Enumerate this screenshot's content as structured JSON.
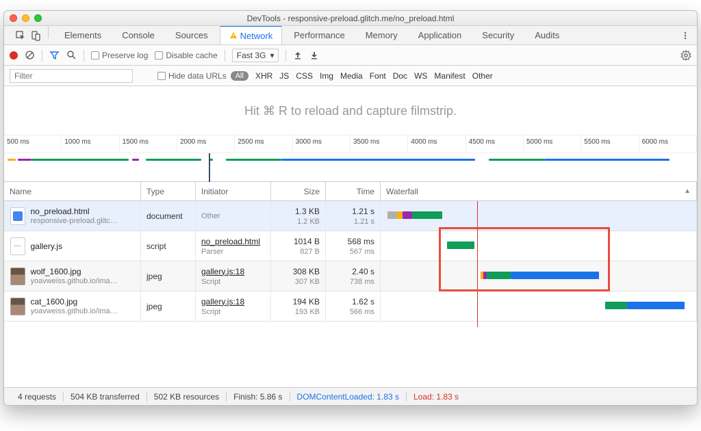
{
  "window": {
    "title": "DevTools - responsive-preload.glitch.me/no_preload.html"
  },
  "tabs": {
    "items": [
      "Elements",
      "Console",
      "Sources",
      "Network",
      "Performance",
      "Memory",
      "Application",
      "Security",
      "Audits"
    ],
    "active": "Network"
  },
  "toolbar": {
    "preserve_log": "Preserve log",
    "disable_cache": "Disable cache",
    "throttle": "Fast 3G"
  },
  "filter": {
    "placeholder": "Filter",
    "hide_data": "Hide data URLs",
    "all": "All",
    "types": [
      "XHR",
      "JS",
      "CSS",
      "Img",
      "Media",
      "Font",
      "Doc",
      "WS",
      "Manifest",
      "Other"
    ]
  },
  "banner": "Hit ⌘ R to reload and capture filmstrip.",
  "ruler": [
    "500 ms",
    "1000 ms",
    "1500 ms",
    "2000 ms",
    "2500 ms",
    "3000 ms",
    "3500 ms",
    "4000 ms",
    "4500 ms",
    "5000 ms",
    "5500 ms",
    "6000 ms"
  ],
  "columns": {
    "name": "Name",
    "type": "Type",
    "initiator": "Initiator",
    "size": "Size",
    "time": "Time",
    "waterfall": "Waterfall"
  },
  "rows": [
    {
      "name": "no_preload.html",
      "sub": "responsive-preload.glitc…",
      "type": "document",
      "initiator": "Other",
      "initiator_sub": "",
      "size": "1.3 KB",
      "size_sub": "1.2 KB",
      "time": "1.21 s",
      "time_sub": "1.21 s",
      "icon": "html"
    },
    {
      "name": "gallery.js",
      "sub": "",
      "type": "script",
      "initiator": "no_preload.html",
      "initiator_sub": "Parser",
      "size": "1014 B",
      "size_sub": "827 B",
      "time": "568 ms",
      "time_sub": "567 ms",
      "icon": "js"
    },
    {
      "name": "wolf_1600.jpg",
      "sub": "yoavweiss.github.io/ima…",
      "type": "jpeg",
      "initiator": "gallery.js:18",
      "initiator_sub": "Script",
      "size": "308 KB",
      "size_sub": "307 KB",
      "time": "2.40 s",
      "time_sub": "738 ms",
      "icon": "img"
    },
    {
      "name": "cat_1600.jpg",
      "sub": "yoavweiss.github.io/ima…",
      "type": "jpeg",
      "initiator": "gallery.js:18",
      "initiator_sub": "Script",
      "size": "194 KB",
      "size_sub": "193 KB",
      "time": "1.62 s",
      "time_sub": "566 ms",
      "icon": "img"
    }
  ],
  "status": {
    "requests": "4 requests",
    "transferred": "504 KB transferred",
    "resources": "502 KB resources",
    "finish": "Finish: 5.86 s",
    "dcl": "DOMContentLoaded: 1.83 s",
    "load": "Load: 1.83 s"
  }
}
